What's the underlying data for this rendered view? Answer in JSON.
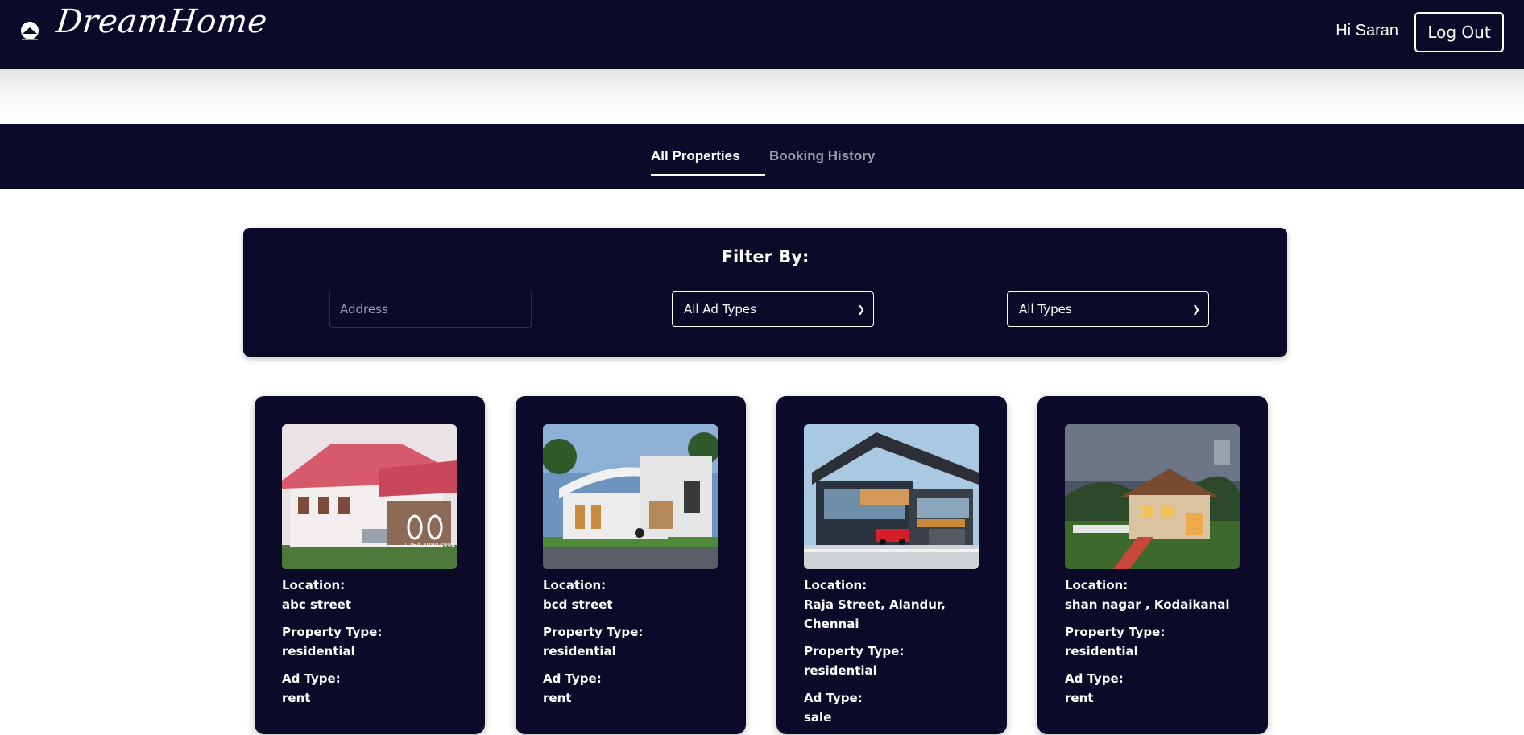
{
  "header": {
    "brand": "DreamHome",
    "greeting": "Hi Saran",
    "logout_label": "Log Out"
  },
  "tabs": [
    {
      "label": "All Properties",
      "active": true
    },
    {
      "label": "Booking History",
      "active": false
    }
  ],
  "filter": {
    "title": "Filter By:",
    "address_placeholder": "Address",
    "ad_type_selected": "All Ad Types",
    "property_type_selected": "All Types"
  },
  "labels": {
    "location": "Location:",
    "property_type": "Property Type:",
    "ad_type": "Ad Type:"
  },
  "properties": [
    {
      "location": "abc street",
      "property_type": "residential",
      "ad_type": "rent",
      "image_watermark": "+254 708039945"
    },
    {
      "location": "bcd street",
      "property_type": "residential",
      "ad_type": "rent"
    },
    {
      "location": "Raja Street, Alandur, Chennai",
      "property_type": "residential",
      "ad_type": "sale"
    },
    {
      "location": "shan nagar , Kodaikanal",
      "property_type": "residential",
      "ad_type": "rent"
    }
  ],
  "colors": {
    "navy": "#0b0b29",
    "white": "#ffffff",
    "inactive_tab": "#9a9aa6"
  },
  "icons": {
    "logo": "house-logo-icon",
    "dropdown": "chevron-down-icon"
  }
}
